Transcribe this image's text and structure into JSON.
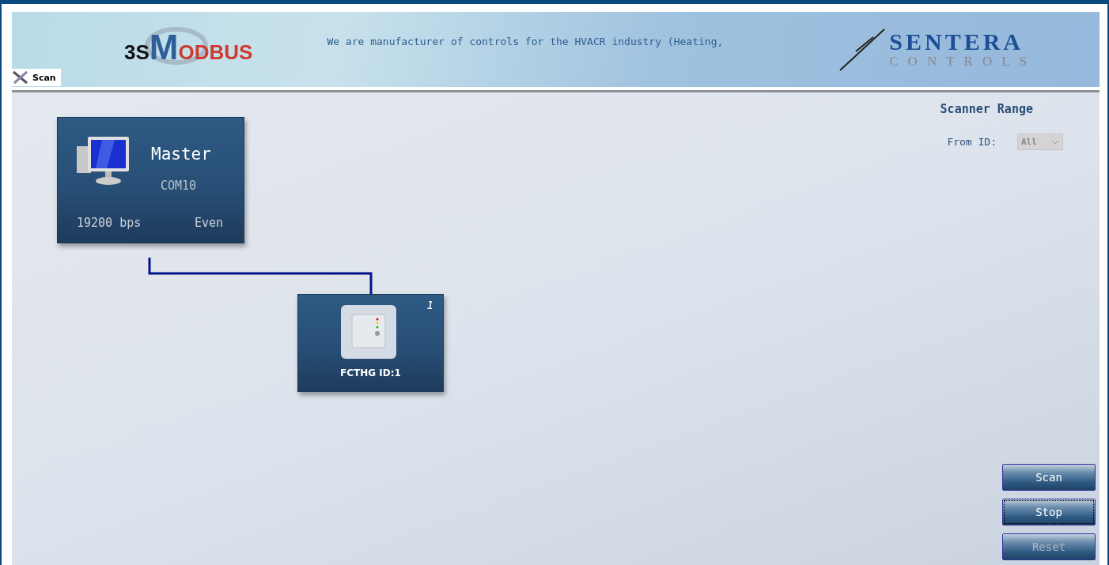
{
  "banner": {
    "logo_left": {
      "prefix": "3S",
      "initial": "M",
      "rest": "ODBUS"
    },
    "tagline": "We are manufacturer of controls for the HVACR industry (Heating,",
    "logo_right": {
      "name": "SENTERA",
      "subtitle": "CONTROLS"
    }
  },
  "tabs": [
    {
      "label": "Scan",
      "selected": true
    }
  ],
  "master": {
    "title": "Master",
    "port": "COM10",
    "baud": "19200 bps",
    "parity": "Even"
  },
  "devices": [
    {
      "name": "FCTHG ID:1",
      "number": "1"
    }
  ],
  "scanner_range": {
    "title": "Scanner Range",
    "from_label": "From ID:",
    "from_value": "All",
    "disabled": true
  },
  "buttons": [
    {
      "label": "Scan",
      "disabled": false,
      "focused": false
    },
    {
      "label": "Stop",
      "disabled": false,
      "focused": true
    },
    {
      "label": "Reset",
      "disabled": true,
      "focused": false
    }
  ]
}
